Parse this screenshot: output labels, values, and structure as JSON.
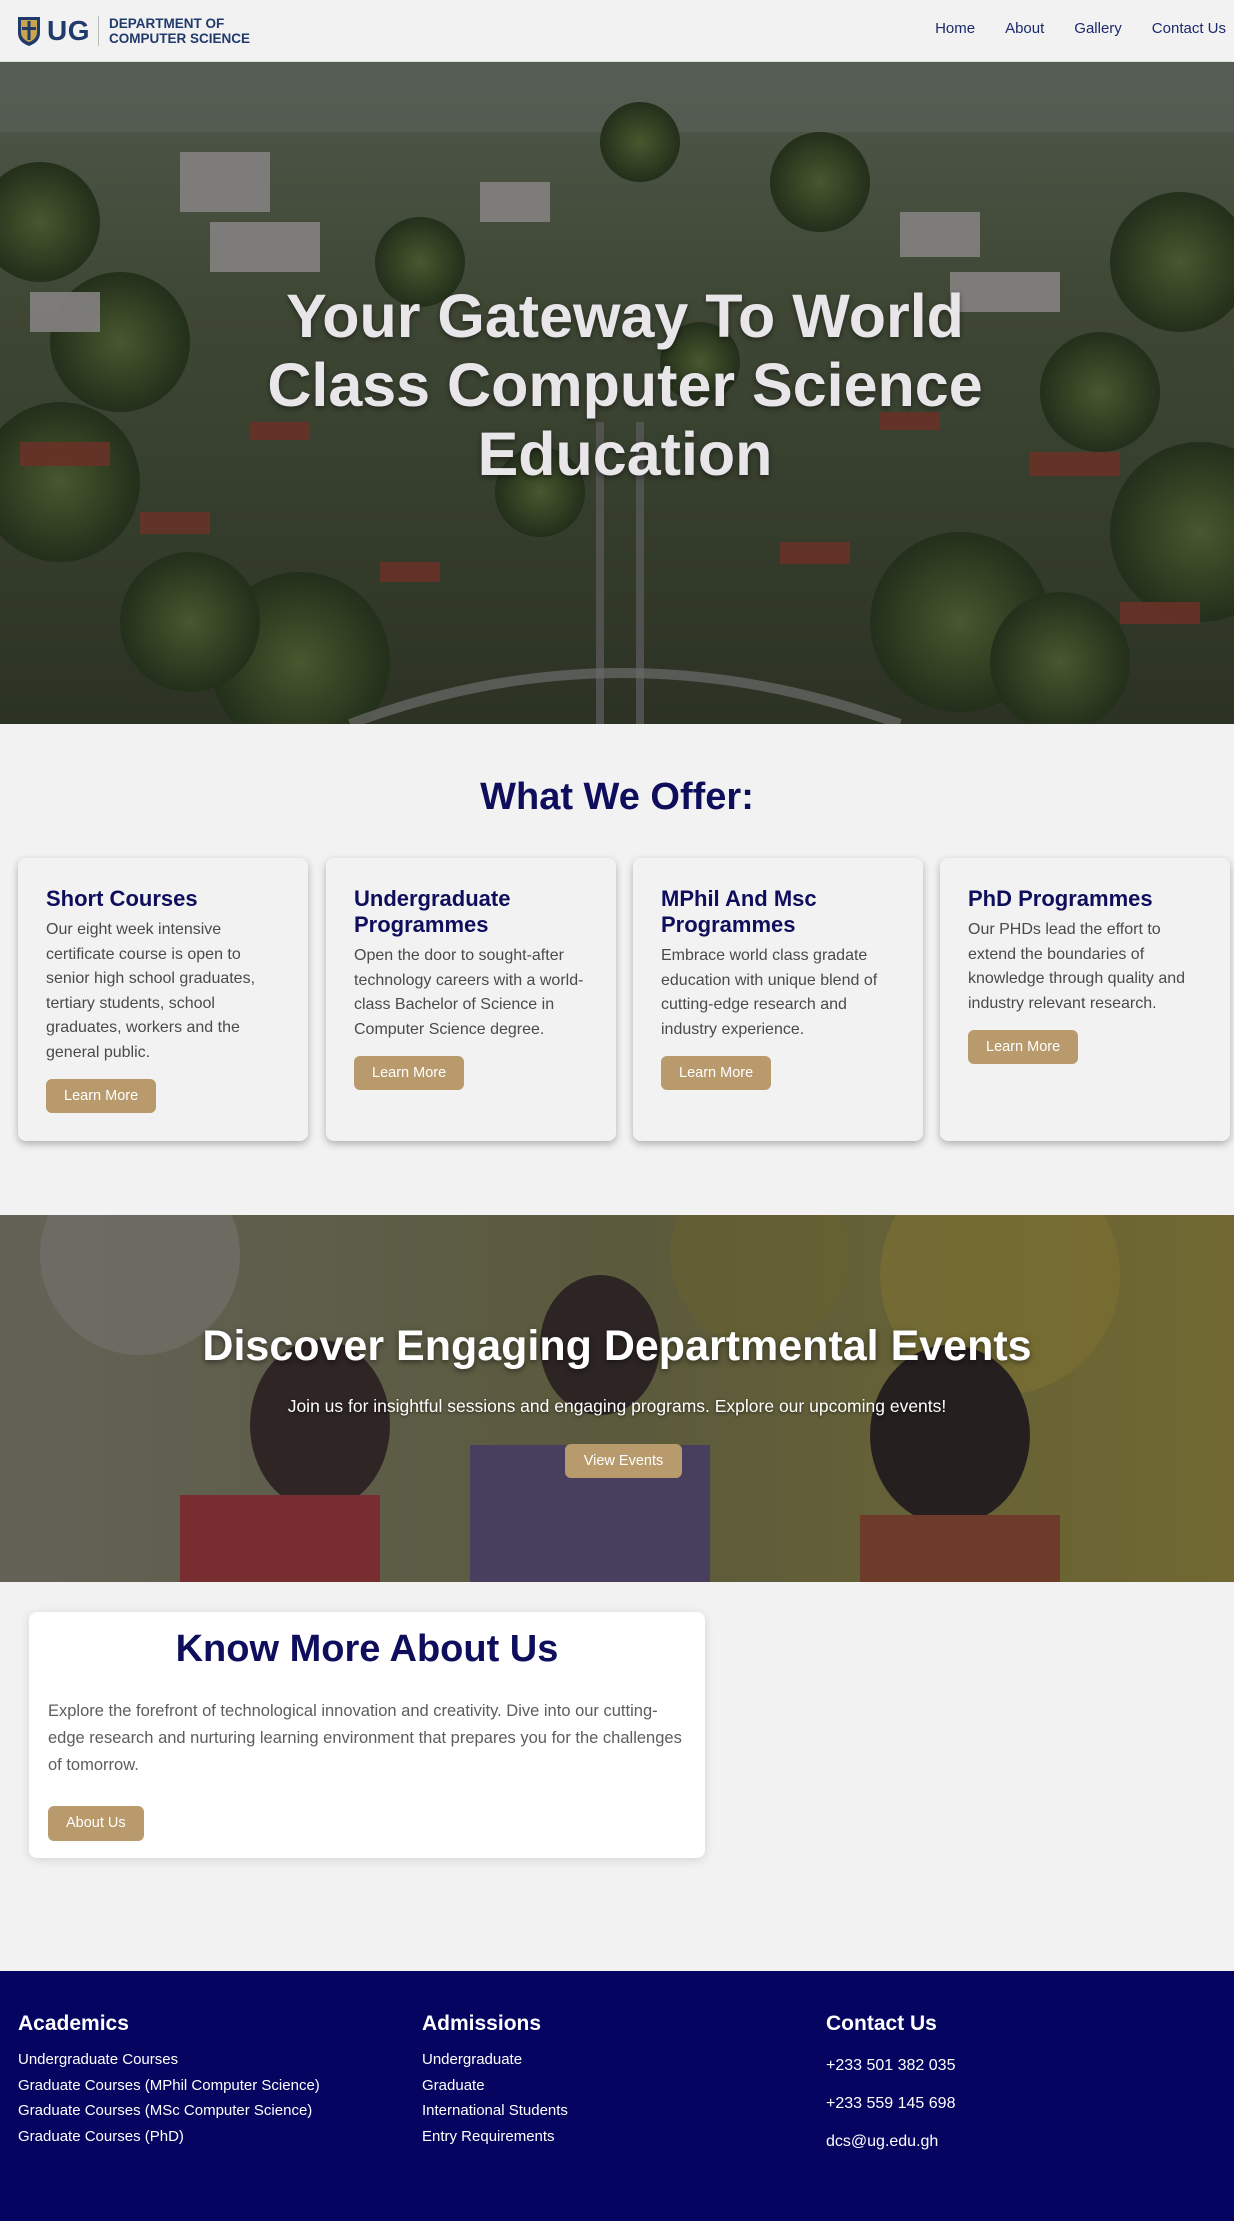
{
  "header": {
    "logo_text": "UG",
    "dept_line1": "DEPARTMENT OF",
    "dept_line2": "COMPUTER SCIENCE",
    "nav": [
      {
        "label": "Home"
      },
      {
        "label": "About"
      },
      {
        "label": "Gallery"
      },
      {
        "label": "Contact Us"
      }
    ]
  },
  "hero": {
    "title": "Your Gateway To World Class Computer Science Education"
  },
  "offers": {
    "title": "What We Offer:",
    "cards": [
      {
        "title": "Short Courses",
        "text": "Our eight week intensive certificate course is open to senior high school graduates, tertiary students, school graduates, workers and the general public.",
        "button": "Learn More"
      },
      {
        "title": "Undergraduate Programmes",
        "text": "Open the door to sought-after technology careers with a world-class Bachelor of Science in Computer Science degree.",
        "button": "Learn More"
      },
      {
        "title": "MPhil And Msc Programmes",
        "text": "Embrace world class gradate education with unique blend of cutting-edge research and industry experience.",
        "button": "Learn More"
      },
      {
        "title": "PhD Programmes",
        "text": "Our PHDs lead the effort to extend the boundaries of knowledge through quality and industry relevant research.",
        "button": "Learn More"
      }
    ]
  },
  "events": {
    "title": "Discover Engaging Departmental Events",
    "subtitle": "Join us for insightful sessions and engaging programs. Explore our upcoming events!",
    "button": "View Events"
  },
  "about": {
    "title": "Know More About Us",
    "text": "Explore the forefront of technological innovation and creativity. Dive into our cutting-edge research and nurturing learning environment that prepares you for the challenges of tomorrow.",
    "button": "About Us"
  },
  "footer": {
    "academics": {
      "title": "Academics",
      "links": [
        "Undergraduate Courses",
        "Graduate Courses (MPhil Computer Science)",
        "Graduate Courses (MSc Computer Science)",
        "Graduate Courses (PhD)"
      ]
    },
    "admissions": {
      "title": "Admissions",
      "links": [
        "Undergraduate",
        "Graduate",
        "International Students",
        "Entry Requirements"
      ]
    },
    "contact": {
      "title": "Contact Us",
      "items": [
        "+233 501 382 035",
        "+233 559 145 698",
        "dcs@ug.edu.gh"
      ]
    }
  },
  "colors": {
    "navy": "#0e0e5c",
    "footer_bg": "#050561",
    "accent_button": "#b89a6c",
    "page_bg": "#f2f2f2"
  }
}
